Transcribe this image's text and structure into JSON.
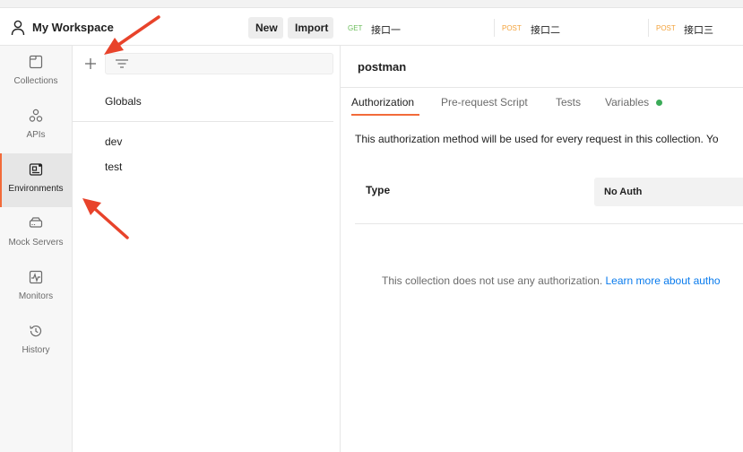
{
  "workspace": {
    "title": "My Workspace",
    "new_label": "New",
    "import_label": "Import"
  },
  "sidebar": {
    "items": [
      {
        "label": "Collections",
        "icon": "collections-icon"
      },
      {
        "label": "APIs",
        "icon": "apis-icon"
      },
      {
        "label": "Environments",
        "icon": "environments-icon",
        "active": true
      },
      {
        "label": "Mock Servers",
        "icon": "mock-servers-icon"
      },
      {
        "label": "Monitors",
        "icon": "monitors-icon"
      },
      {
        "label": "History",
        "icon": "history-icon"
      }
    ]
  },
  "environments": {
    "globals_label": "Globals",
    "items": [
      "dev",
      "test"
    ]
  },
  "tabs": [
    {
      "method": "GET",
      "name": "接口一",
      "method_color": "#6bbd5b"
    },
    {
      "method": "POST",
      "name": "接口二",
      "method_color": "#f3a23b"
    },
    {
      "method": "POST",
      "name": "接口三",
      "method_color": "#f3a23b"
    }
  ],
  "main": {
    "collection_name": "postman",
    "subtabs": [
      "Authorization",
      "Pre-request Script",
      "Tests",
      "Variables"
    ],
    "active_subtab": "Authorization",
    "description": "This authorization method will be used for every request in this collection. Yo",
    "type_label": "Type",
    "type_value": "No Auth",
    "noauth_message": "This collection does not use any authorization.",
    "noauth_link": "Learn more about autho"
  },
  "colors": {
    "accent": "#f26b3a",
    "annotation": "#e8432b",
    "link": "#097bed",
    "variables_dot": "#3bab58"
  }
}
